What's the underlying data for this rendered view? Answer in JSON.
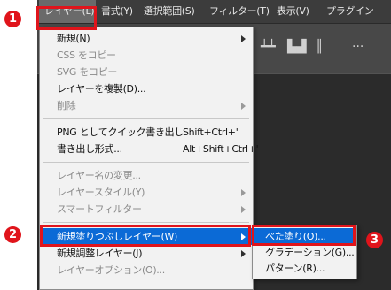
{
  "menubar": {
    "items": [
      "レイヤー(L)",
      "書式(Y)",
      "選択範囲(S)",
      "フィルター(T)",
      "表示(V)",
      "プラグイン"
    ]
  },
  "toolbar": {
    "icons": [
      "align-distribute-icon",
      "align-bottom-icon",
      "align-vertical-icon",
      "more-icon"
    ]
  },
  "layer_menu": {
    "items": [
      {
        "label": "新規(N)",
        "shortcut": "",
        "submenu": true,
        "disabled": false
      },
      {
        "label": "CSS をコピー",
        "shortcut": "",
        "submenu": false,
        "disabled": true
      },
      {
        "label": "SVG をコピー",
        "shortcut": "",
        "submenu": false,
        "disabled": true
      },
      {
        "label": "レイヤーを複製(D)...",
        "shortcut": "",
        "submenu": false,
        "disabled": false
      },
      {
        "label": "削除",
        "shortcut": "",
        "submenu": true,
        "disabled": true
      },
      {
        "label": "PNG としてクイック書き出し",
        "shortcut": "Shift+Ctrl+'",
        "submenu": false,
        "disabled": false
      },
      {
        "label": "書き出し形式...",
        "shortcut": "Alt+Shift+Ctrl+'",
        "submenu": false,
        "disabled": false
      },
      {
        "label": "レイヤー名の変更...",
        "shortcut": "",
        "submenu": false,
        "disabled": true
      },
      {
        "label": "レイヤースタイル(Y)",
        "shortcut": "",
        "submenu": true,
        "disabled": true
      },
      {
        "label": "スマートフィルター",
        "shortcut": "",
        "submenu": true,
        "disabled": true
      },
      {
        "label": "新規塗りつぶしレイヤー(W)",
        "shortcut": "",
        "submenu": true,
        "disabled": false,
        "highlighted": true
      },
      {
        "label": "新規調整レイヤー(J)",
        "shortcut": "",
        "submenu": true,
        "disabled": false
      },
      {
        "label": "レイヤーオプション(O)...",
        "shortcut": "",
        "submenu": false,
        "disabled": true
      }
    ]
  },
  "fill_submenu": {
    "items": [
      "べた塗り(O)...",
      "グラデーション(G)...",
      "パターン(R)..."
    ]
  },
  "annotations": {
    "badges": [
      "1",
      "2",
      "3"
    ],
    "color": "#e0141b"
  },
  "colors": {
    "highlight": "#0b6ad6",
    "menubar": "#3c3c3c"
  }
}
